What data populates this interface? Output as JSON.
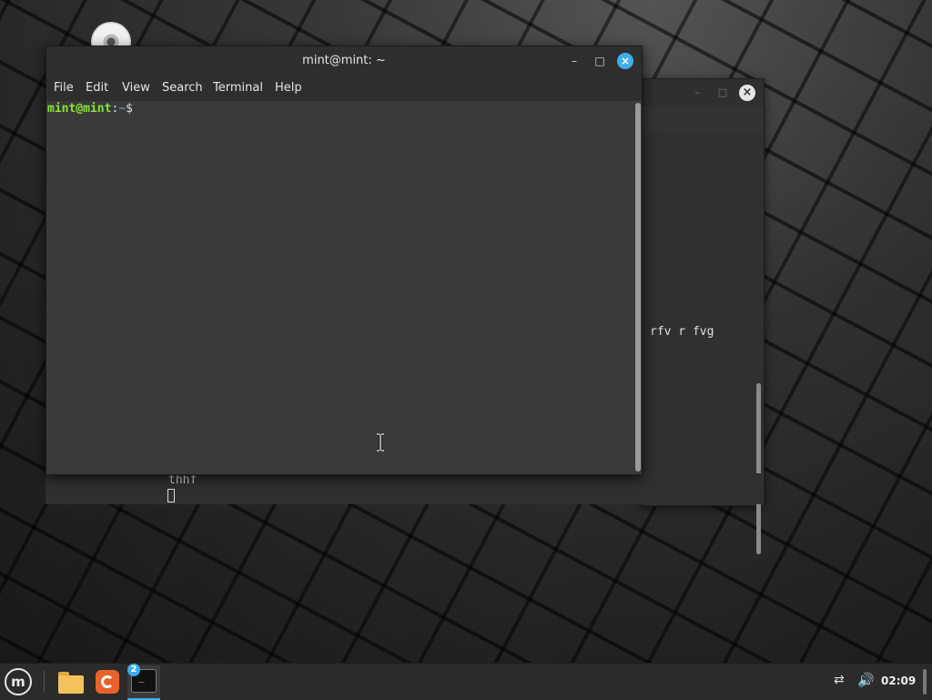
{
  "desktop": {
    "icon": "optical-disc-icon"
  },
  "back_window": {
    "minimize": "–",
    "maximize": "□",
    "close": "×",
    "line_text": "rfv r fvg",
    "bottom_text": "thhf"
  },
  "front_window": {
    "title": "mint@mint: ~",
    "minimize": "–",
    "maximize": "□",
    "close": "×",
    "menu": [
      "File",
      "Edit",
      "View",
      "Search",
      "Terminal",
      "Help"
    ],
    "prompt": {
      "user": "mint@mint",
      "sep": ":",
      "path": "~",
      "symbol": "$"
    }
  },
  "taskbar": {
    "menu_logo": "m",
    "apps": [
      "folder-icon",
      "firefox-icon",
      "terminal-icon"
    ],
    "terminal_badge": "2",
    "terminal_glyph": "_",
    "net_glyph": "⇄",
    "vol_glyph": "🔊",
    "clock": "02:09"
  },
  "colors": {
    "accent": "#3daee9",
    "prompt_user": "#8ae234",
    "prompt_path": "#729fcf"
  }
}
